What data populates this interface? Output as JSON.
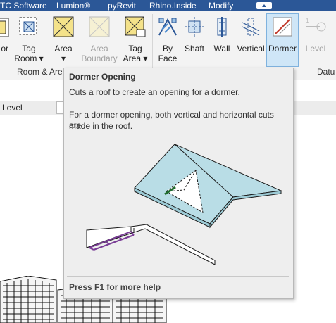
{
  "tabbar": {
    "tabs": [
      "TC Software",
      "Lumion®",
      "pyRevit",
      "Rhino.Inside",
      "Modify"
    ]
  },
  "ribbon": {
    "buttons": [
      {
        "line1": "",
        "line2": "or",
        "state": "normal"
      },
      {
        "line1": "Tag",
        "line2": "Room ▾",
        "state": "normal"
      },
      {
        "line1": "Area",
        "line2": "▾",
        "state": "normal"
      },
      {
        "line1": "Area",
        "line2": "Boundary",
        "state": "disabled"
      },
      {
        "line1": "Tag",
        "line2": "Area ▾",
        "state": "normal"
      },
      {
        "line1": "By",
        "line2": "Face",
        "state": "normal"
      },
      {
        "line1": "Shaft",
        "line2": "",
        "state": "normal"
      },
      {
        "line1": "Wall",
        "line2": "",
        "state": "normal"
      },
      {
        "line1": "Vertical",
        "line2": "",
        "state": "normal"
      },
      {
        "line1": "Dormer",
        "line2": "",
        "state": "active"
      },
      {
        "line1": "Level",
        "line2": "",
        "state": "disabled"
      }
    ],
    "panel_labels": {
      "room_area": "Room & Are",
      "datum": "Datu"
    }
  },
  "project_bar": {
    "level_label": "Level"
  },
  "tooltip": {
    "title": "Dormer Opening",
    "line1": "Cuts a roof to create an opening for a dormer.",
    "line2": "For a dormer opening, both vertical and horizontal cuts are",
    "line3": "made in the roof.",
    "help": "Press F1 for more help"
  },
  "colors": {
    "tabbar": "#2b5797",
    "ribbon": "#f3f3f3",
    "active": "#cfe6f7",
    "roof": "#b9dde6",
    "dormer_cut": "#7a3d96"
  }
}
